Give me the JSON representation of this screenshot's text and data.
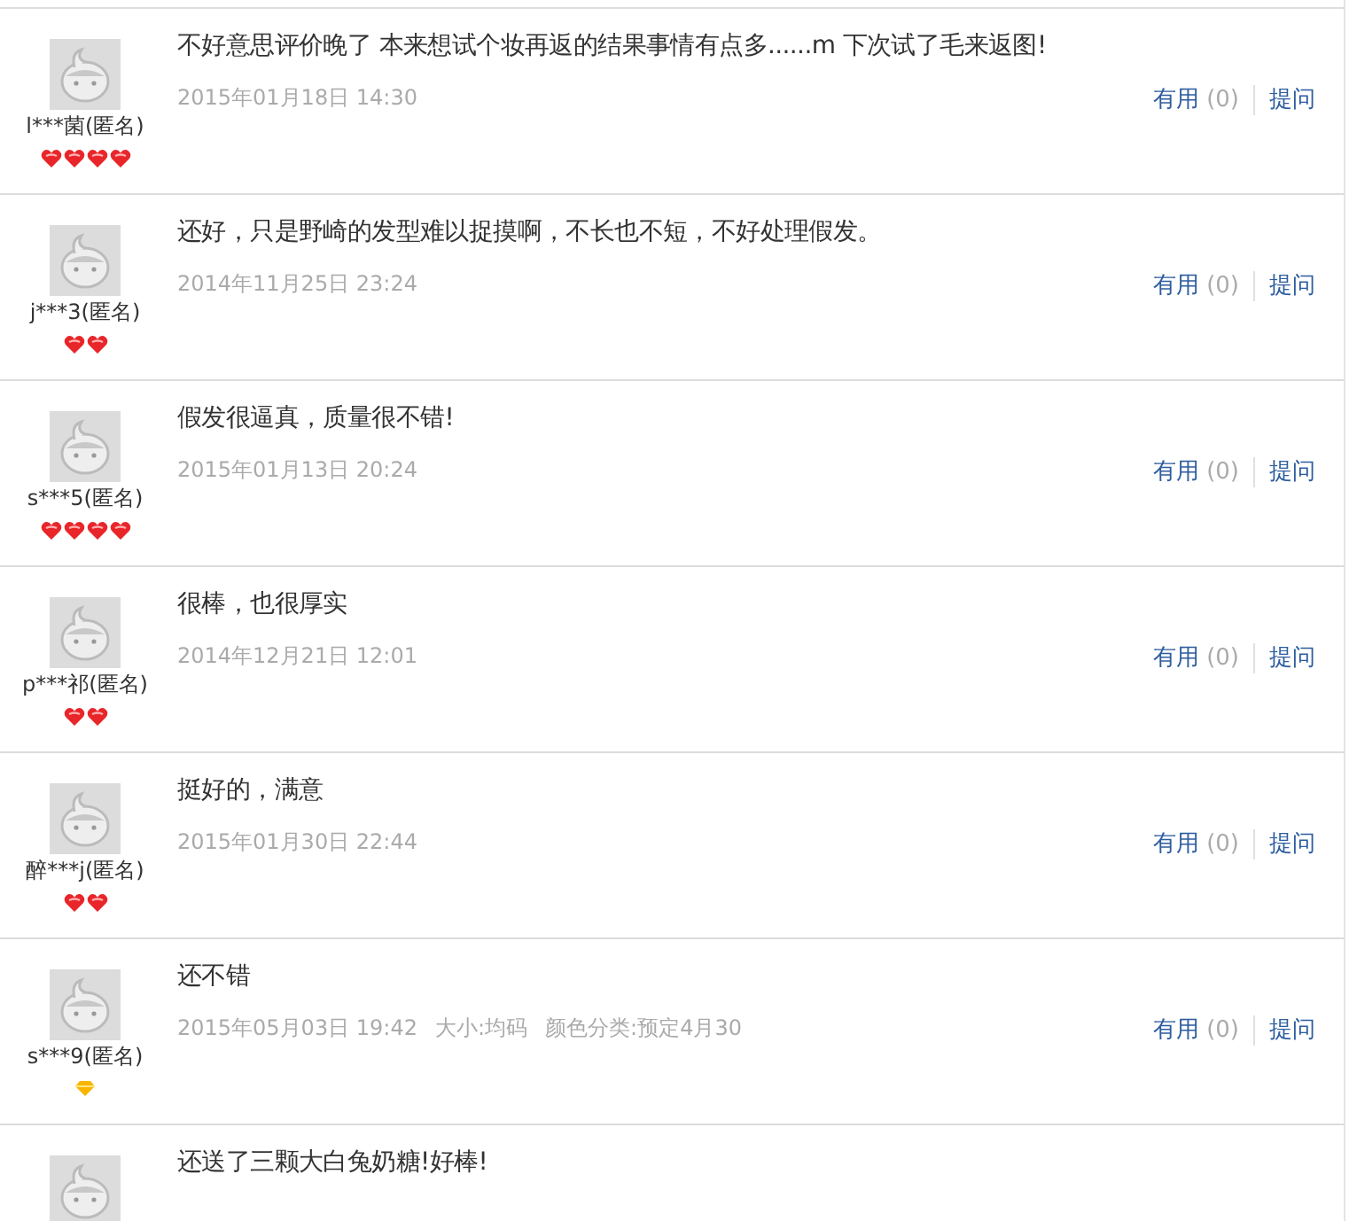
{
  "reviews": [
    {
      "user": "l***菌(匿名)",
      "rank_icons": [
        {
          "kind": "heart"
        },
        {
          "kind": "heart"
        },
        {
          "kind": "heart"
        },
        {
          "kind": "heart"
        }
      ],
      "comment": "不好意思评价晚了 本来想试个妆再返的结果事情有点多......m 下次试了毛来返图!",
      "date": "2015年01月18日 14:30",
      "useful_label": "有用",
      "useful_count": "(0)",
      "ask_label": "提问"
    },
    {
      "user": "j***3(匿名)",
      "rank_icons": [
        {
          "kind": "heart"
        },
        {
          "kind": "heart"
        }
      ],
      "comment": "还好，只是野崎的发型难以捉摸啊，不长也不短，不好处理假发。",
      "date": "2014年11月25日 23:24",
      "useful_label": "有用",
      "useful_count": "(0)",
      "ask_label": "提问"
    },
    {
      "user": "s***5(匿名)",
      "rank_icons": [
        {
          "kind": "heart"
        },
        {
          "kind": "heart"
        },
        {
          "kind": "heart"
        },
        {
          "kind": "heart"
        }
      ],
      "comment": "假发很逼真，质量很不错!",
      "date": "2015年01月13日 20:24",
      "useful_label": "有用",
      "useful_count": "(0)",
      "ask_label": "提问"
    },
    {
      "user": "p***祁(匿名)",
      "rank_icons": [
        {
          "kind": "heart"
        },
        {
          "kind": "heart"
        }
      ],
      "comment": "很棒，也很厚实",
      "date": "2014年12月21日 12:01",
      "useful_label": "有用",
      "useful_count": "(0)",
      "ask_label": "提问"
    },
    {
      "user": "醉***j(匿名)",
      "rank_icons": [
        {
          "kind": "heart"
        },
        {
          "kind": "heart"
        }
      ],
      "comment": "挺好的，满意",
      "date": "2015年01月30日 22:44",
      "useful_label": "有用",
      "useful_count": "(0)",
      "ask_label": "提问"
    },
    {
      "user": "s***9(匿名)",
      "rank_icons": [
        {
          "kind": "diamond"
        }
      ],
      "comment": "还不错",
      "date": "2015年05月03日 19:42",
      "specs": [
        "大小:均码",
        "颜色分类:预定4月30"
      ],
      "useful_label": "有用",
      "useful_count": "(0)",
      "ask_label": "提问"
    },
    {
      "comment": "还送了三颗大白兔奶糖!好棒!"
    }
  ]
}
